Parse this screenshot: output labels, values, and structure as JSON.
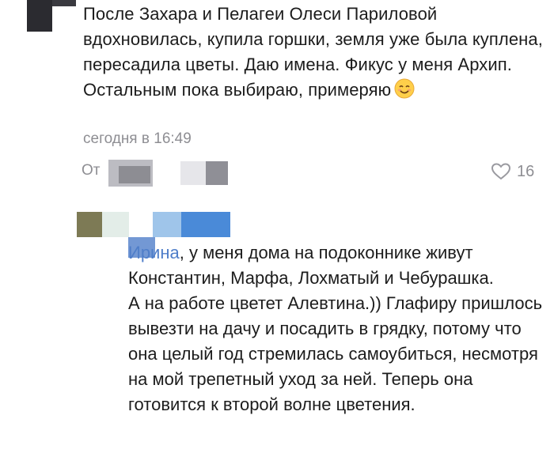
{
  "comment1": {
    "text": "После Захара и Пелагеи Олеси Париловой вдохновилась, купила горшки, земля уже была куплена, пересадила цветы. Даю имена. Фикус у меня Архип. Остальным пока выбираю, примеряю",
    "emoji": "smiling-face-icon",
    "timestamp": "сегодня в 16:49",
    "reply_label": "От",
    "likes": "16"
  },
  "comment2": {
    "mention": "Ирина",
    "text": ", у меня дома на подоконнике живут Константин, Марфа, Лохматый и Чебурашка.",
    "text2": "А на работе цветет Алевтина.)) Глафиру пришлось вывезти на дачу и посадить в грядку, потому что она целый год стремилась самоубиться, несмотря на мой трепетный уход за ней. Теперь она готовится к второй волне цветения."
  },
  "colors": {
    "mention": "#4f7ec9",
    "secondary": "#8e8e93",
    "text": "#1c1c1c"
  }
}
